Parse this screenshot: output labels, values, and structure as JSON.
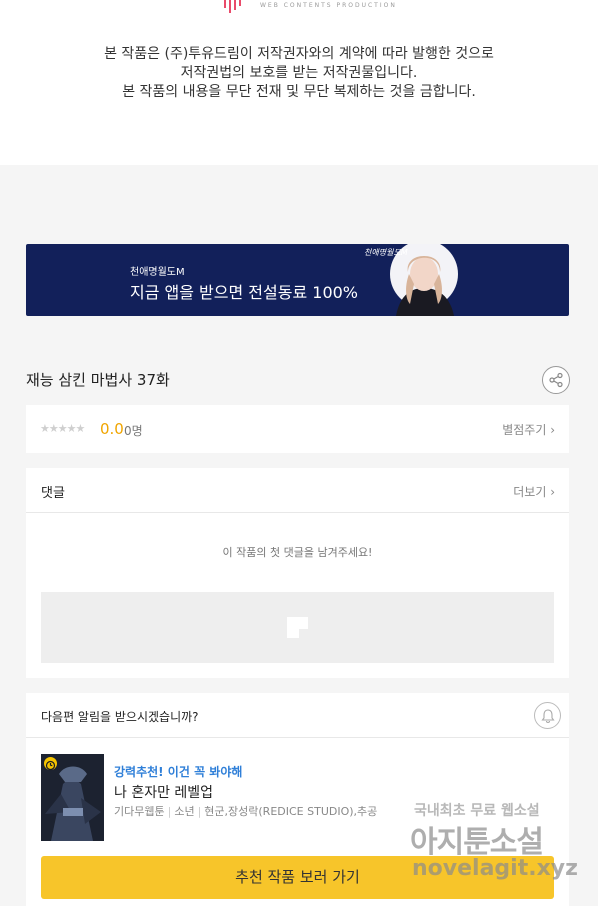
{
  "logo": {
    "text": "WEB CONTENTS PRODUCTION"
  },
  "copyright": {
    "line1": "본 작품은 (주)투유드림이 저작권자와의 계약에 따라 발행한 것으로",
    "line2": "저작권법의 보호를 받는 저작권물입니다.",
    "line3": "본 작품의 내용을 무단 전재 및 무단 복제하는 것을 금합니다."
  },
  "banner": {
    "small_text": "천애명월도M",
    "main_text": "지금 앱을 받으면 전설동료 100%",
    "brand_text": "천애명월도M",
    "bg_color": "#12205a"
  },
  "episode": {
    "title": "재능 삼킨 마법사 37화"
  },
  "rating": {
    "stars": "★★★★★",
    "value": "0.0",
    "count": "0명",
    "rate_link": "별점주기 ›"
  },
  "comments": {
    "title": "댓글",
    "more_link": "더보기 ›",
    "empty_message": "이 작품의 첫 댓글을 남겨주세요!"
  },
  "notify": {
    "question": "다음편 알림을 받으시겠습니까?"
  },
  "recommendation": {
    "tag": "강력추천! 이건 꼭 봐야해",
    "title": "나 혼자만 레벨업",
    "genre": "기다무웹툰",
    "audience": "소년",
    "authors": "현군,장성락(REDICE STUDIO),추공",
    "button_label": "추천 작품 보러 가기",
    "button_color": "#f7c52a",
    "tag_color": "#2f7fd8"
  },
  "watermark": {
    "line1": "국내최초 무료 웹소설",
    "line2": "아지툰소설",
    "line3": "novelagit.xyz"
  },
  "colors": {
    "rating": "#f0a500"
  }
}
